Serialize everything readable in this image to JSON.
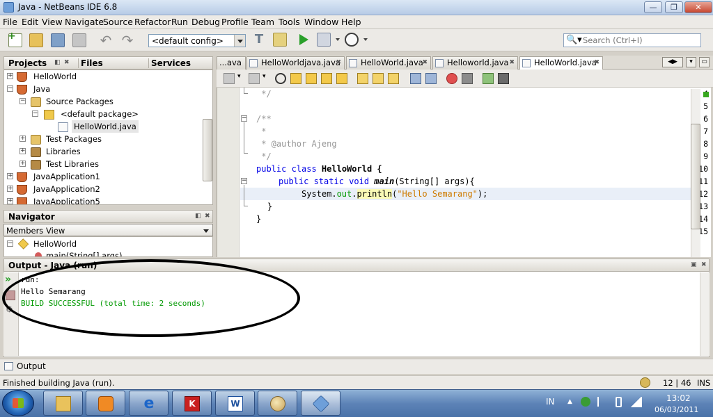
{
  "window": {
    "title": "Java - NetBeans IDE 6.8",
    "min": "—",
    "max": "❐",
    "close": "✕"
  },
  "menu": [
    "File",
    "Edit",
    "View",
    "Navigate",
    "Source",
    "Refactor",
    "Run",
    "Debug",
    "Profile",
    "Team",
    "Tools",
    "Window",
    "Help"
  ],
  "toolbar": {
    "config": "<default config>",
    "search_placeholder": "Search (Ctrl+I)"
  },
  "projects_panel": {
    "tabs": [
      "Projects",
      "Files",
      "Services"
    ],
    "tree": [
      {
        "label": "HelloWorld",
        "icon": "coffee-cup-icon"
      },
      {
        "label": "Java",
        "icon": "coffee-cup-icon"
      },
      {
        "label": "Source Packages",
        "icon": "package-folder-icon"
      },
      {
        "label": "<default package>",
        "icon": "package-icon"
      },
      {
        "label": "HelloWorld.java",
        "icon": "java-file-icon"
      },
      {
        "label": "Test Packages",
        "icon": "package-folder-icon"
      },
      {
        "label": "Libraries",
        "icon": "library-icon"
      },
      {
        "label": "Test Libraries",
        "icon": "library-icon"
      },
      {
        "label": "JavaApplication1",
        "icon": "coffee-cup-icon"
      },
      {
        "label": "JavaApplication2",
        "icon": "coffee-cup-icon"
      },
      {
        "label": "JavaApplication5",
        "icon": "coffee-cup-icon"
      }
    ]
  },
  "navigator": {
    "title": "Navigator",
    "view": "Members View",
    "items": [
      "HelloWorld",
      "main(String[] args)"
    ]
  },
  "editor": {
    "tabs": [
      "...ava",
      "HelloWorldjava.java",
      "HelloWorld.java",
      "Helloworld.java",
      "HelloWorld.java"
    ],
    "lines": [
      "4",
      "5",
      "6",
      "7",
      "8",
      "9",
      "10",
      "11",
      "12",
      "13",
      "14",
      "15"
    ],
    "code": {
      "l4": " */",
      "l6": "/**",
      "l7": " *",
      "l8": " * @author Ajeng",
      "l9": " */",
      "l10_kw": "public class",
      "l10_rest": " HelloWorld {",
      "l11_kw": "public static void",
      "l11_fn": "main",
      "l11_rest": "(String[] args){",
      "l12_a": "System.",
      "l12_field": "out",
      "l12_dot": ".",
      "l12_call": "println",
      "l12_open": "(",
      "l12_str": "\"Hello Semarang\"",
      "l12_close": ");",
      "l13": "}",
      "l14": "}"
    }
  },
  "output": {
    "title": "Output - Java (run)",
    "lines": [
      "run:",
      "Hello Semarang",
      "BUILD SUCCESSFUL (total time: 2 seconds)"
    ],
    "tab": "Output"
  },
  "status": {
    "message": "Finished building Java (run).",
    "position": "12 | 46",
    "mode": "INS"
  },
  "taskbar": {
    "lang": "IN",
    "time": "13:02",
    "date": "06/03/2011"
  }
}
